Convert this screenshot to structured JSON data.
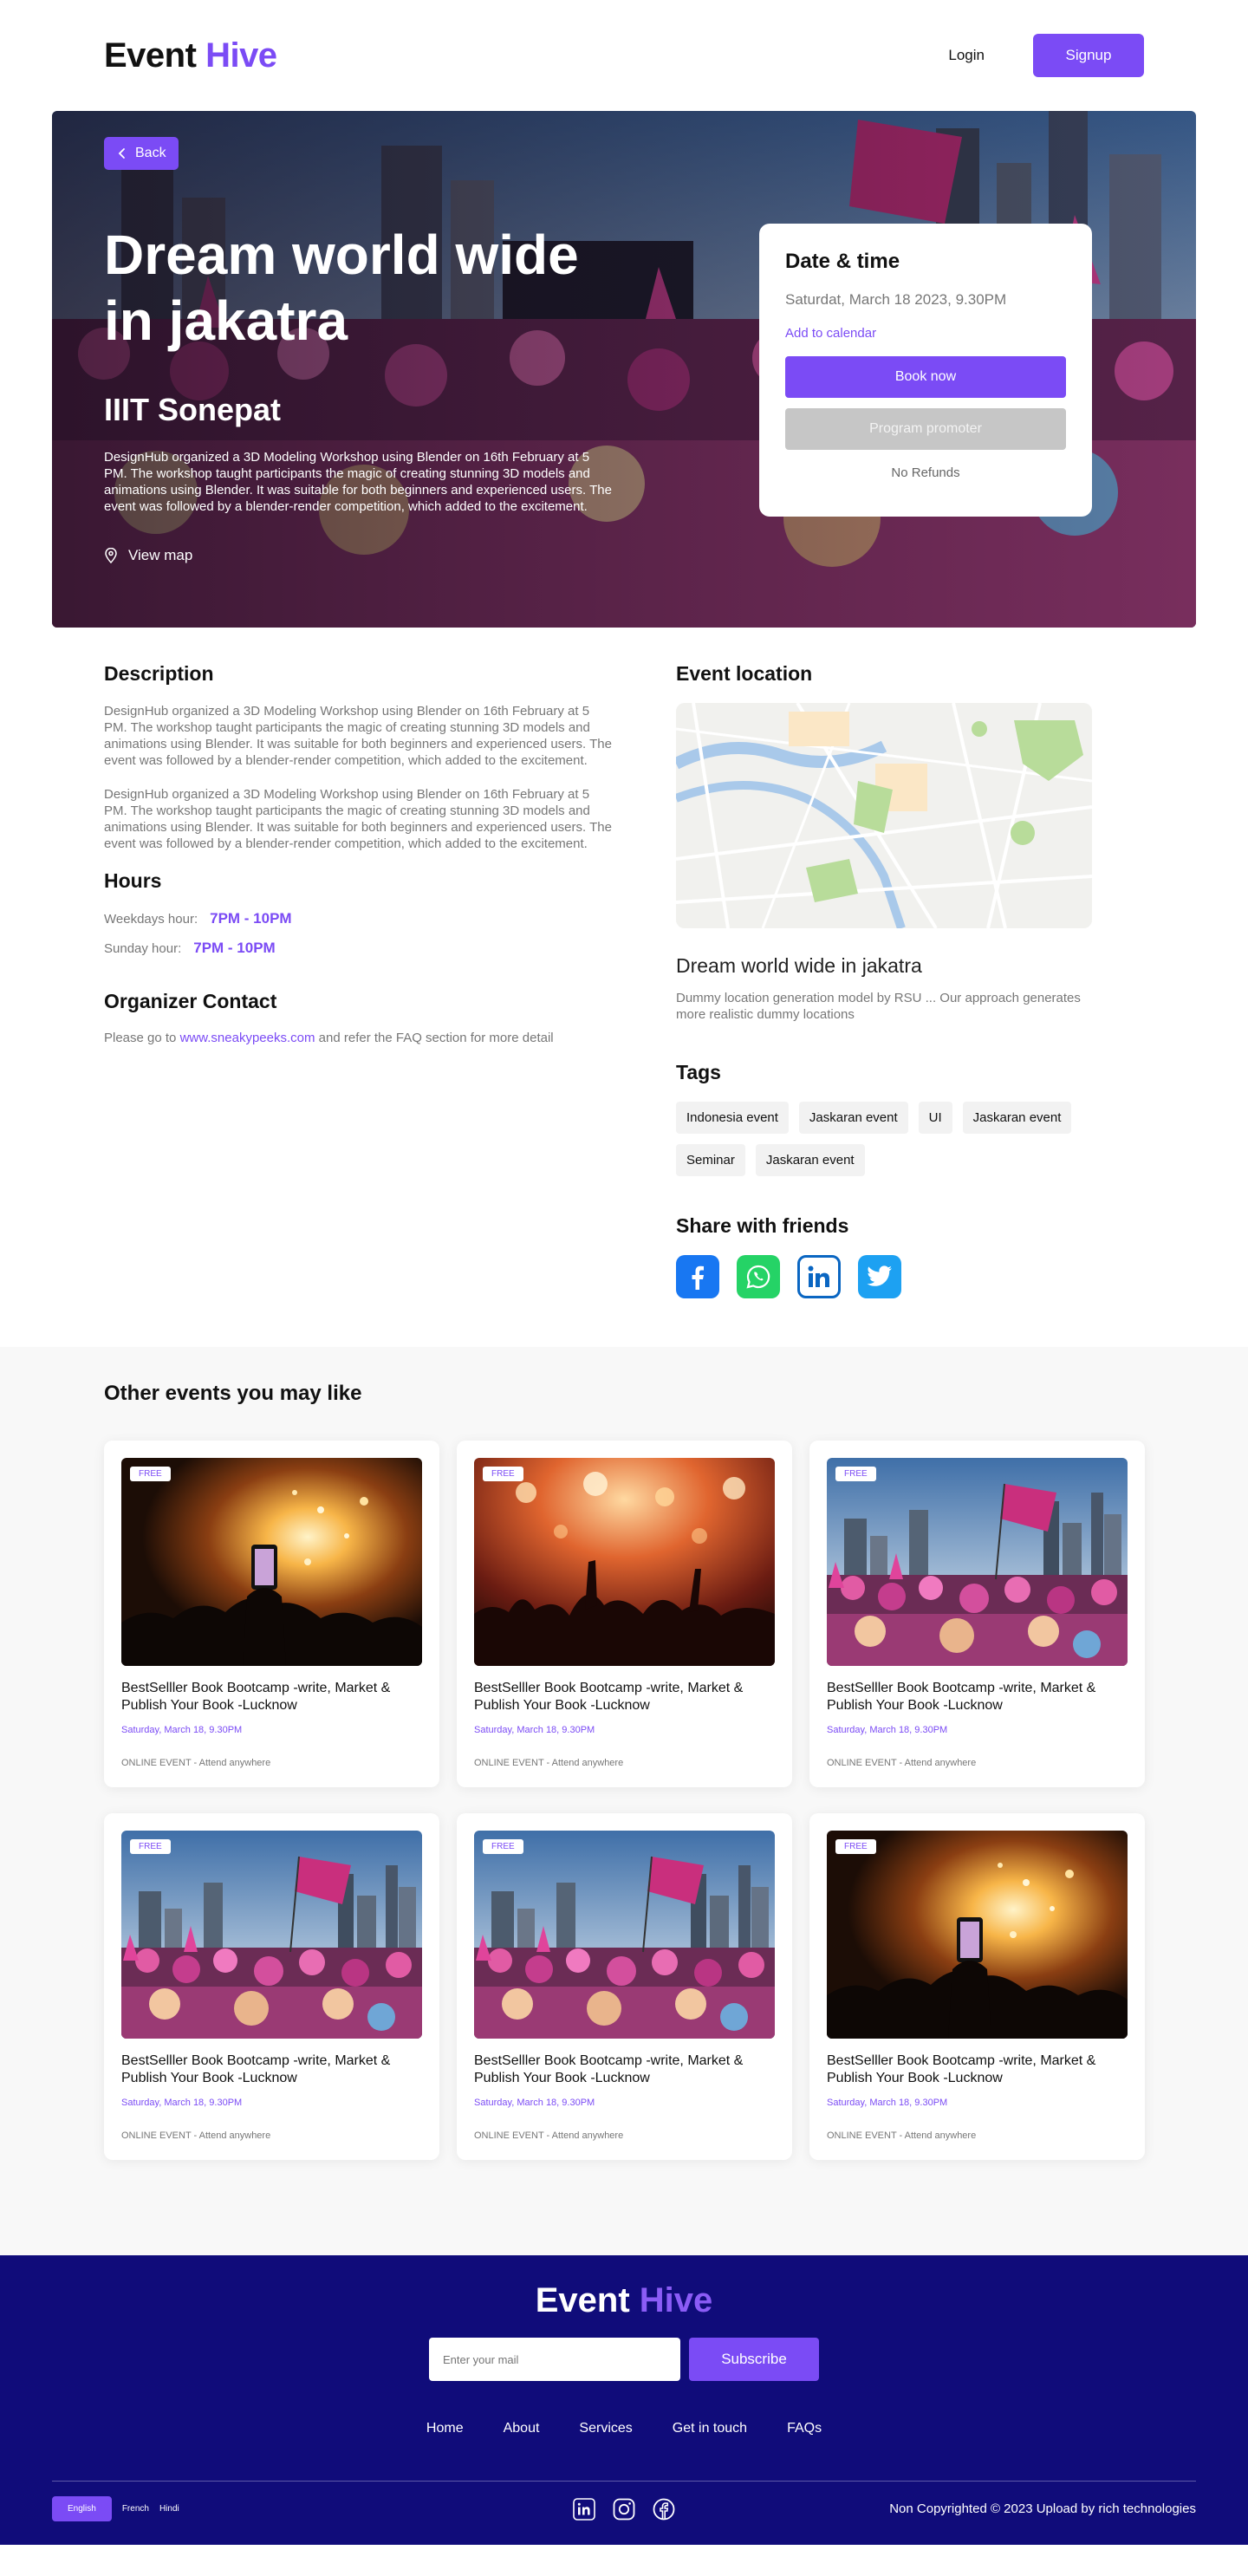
{
  "header": {
    "logo_main": "Event",
    "logo_accent": "Hive",
    "login_label": "Login",
    "signup_label": "Signup"
  },
  "hero": {
    "back_label": "Back",
    "title": "Dream world wide in jakatra",
    "subtitle": "IIIT Sonepat",
    "description": "DesignHub organized a 3D Modeling Workshop using Blender on 16th February at 5 PM. The workshop taught participants the magic of creating stunning 3D models and animations using Blender. It was suitable for both beginners and experienced users. The event was followed by a blender-render competition, which added to the excitement.",
    "view_map_label": "View map",
    "date_card": {
      "heading": "Date & time",
      "date": "Saturdat, March 18 2023, 9.30PM",
      "calendar_link": "Add to calendar",
      "book_label": "Book now",
      "promoter_label": "Program promoter",
      "refund_note": "No Refunds"
    }
  },
  "details": {
    "description_heading": "Description",
    "paragraphs": [
      "DesignHub organized a 3D Modeling Workshop using Blender on 16th February at 5 PM. The workshop taught participants the magic of creating stunning 3D models and animations using Blender. It was suitable for both beginners and experienced users. The event was followed by a blender-render competition, which added to the excitement.",
      "DesignHub organized a 3D Modeling Workshop using Blender on 16th February at 5 PM. The workshop taught participants the magic of creating stunning 3D models and animations using Blender. It was suitable for both beginners and experienced users. The event was followed by a blender-render competition, which added to the excitement."
    ],
    "hours_heading": "Hours",
    "weekdays_label": "Weekdays hour:",
    "weekdays_value": "7PM - 10PM",
    "sunday_label": "Sunday hour:",
    "sunday_value": "7PM - 10PM",
    "organizer_heading": "Organizer Contact",
    "organizer_prefix": "Please go to",
    "organizer_link": "www.sneakypeeks.com",
    "organizer_suffix": "and refer the FAQ section for more detail",
    "location_heading": "Event location",
    "location_title": "Dream world wide in jakatra",
    "location_desc": "Dummy location generation model by RSU ... Our approach generates more realistic dummy locations",
    "tags_heading": "Tags",
    "tags": [
      "Indonesia event",
      "Jaskaran event",
      "UI",
      "Jaskaran event",
      "Seminar",
      "Jaskaran event"
    ],
    "share_heading": "Share with friends"
  },
  "others": {
    "heading": "Other events you may like",
    "cards": [
      {
        "badge": "FREE",
        "title": "BestSelller Book Bootcamp -write, Market & Publish Your Book -Lucknow",
        "date": "Saturday, March 18, 9.30PM",
        "location": "ONLINE EVENT - Attend anywhere",
        "image": "fire-phone"
      },
      {
        "badge": "FREE",
        "title": "BestSelller Book Bootcamp -write, Market & Publish Your Book -Lucknow",
        "date": "Saturday, March 18, 9.30PM",
        "location": "ONLINE EVENT - Attend anywhere",
        "image": "concert"
      },
      {
        "badge": "FREE",
        "title": "BestSelller Book Bootcamp -write, Market & Publish Your Book -Lucknow",
        "date": "Saturday, March 18, 9.30PM",
        "location": "ONLINE EVENT - Attend anywhere",
        "image": "crowd-city"
      },
      {
        "badge": "FREE",
        "title": "BestSelller Book Bootcamp -write, Market & Publish Your Book -Lucknow",
        "date": "Saturday, March 18, 9.30PM",
        "location": "ONLINE EVENT - Attend anywhere",
        "image": "crowd-city"
      },
      {
        "badge": "FREE",
        "title": "BestSelller Book Bootcamp -write, Market & Publish Your Book -Lucknow",
        "date": "Saturday, March 18, 9.30PM",
        "location": "ONLINE EVENT - Attend anywhere",
        "image": "crowd-city"
      },
      {
        "badge": "FREE",
        "title": "BestSelller Book Bootcamp -write, Market & Publish Your Book -Lucknow",
        "date": "Saturday, March 18, 9.30PM",
        "location": "ONLINE EVENT - Attend anywhere",
        "image": "fire-phone"
      }
    ]
  },
  "footer": {
    "logo_main": "Event",
    "logo_accent": "Hive",
    "email_placeholder": "Enter your mail",
    "subscribe_label": "Subscribe",
    "nav": [
      "Home",
      "About",
      "Services",
      "Get in touch",
      "FAQs"
    ],
    "languages": [
      "English",
      "French",
      "Hindi"
    ],
    "copyright": "Non Copyrighted © 2023 Upload by rich technologies"
  },
  "colors": {
    "accent": "#7B4BF5",
    "footer_bg": "#100C7A",
    "facebook": "#1877F2",
    "whatsapp": "#25D366",
    "linkedin": "#0A66C2",
    "twitter": "#1DA1F2"
  }
}
